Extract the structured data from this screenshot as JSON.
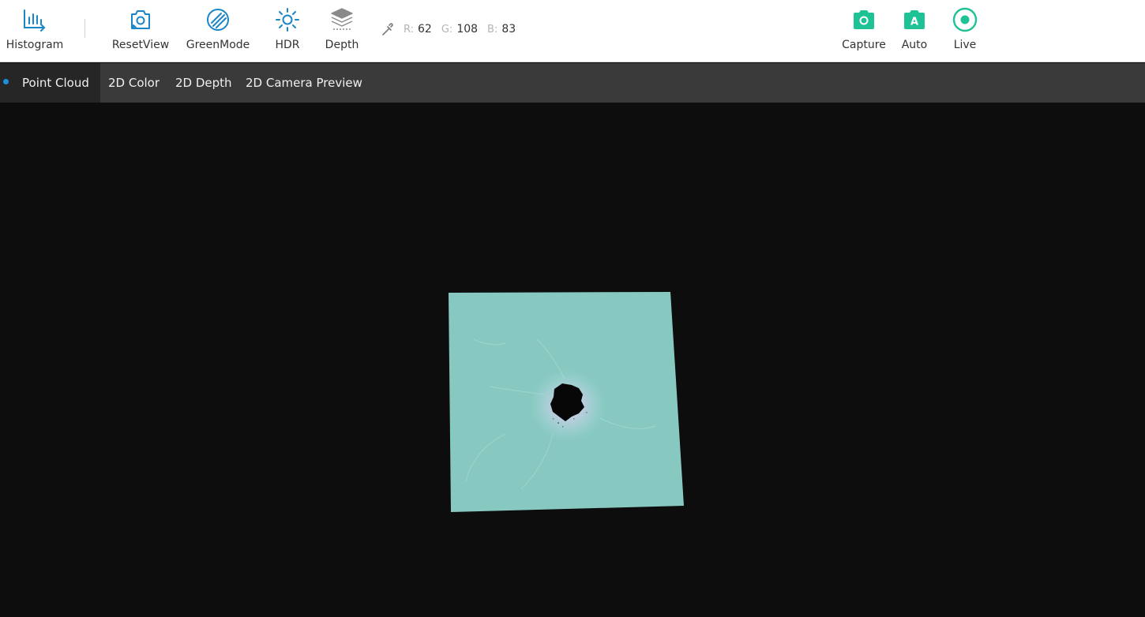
{
  "toolbar": {
    "left": [
      {
        "id": "histogram",
        "label": "Histogram",
        "icon": "histogram-icon"
      },
      {
        "id": "resetview",
        "label": "ResetView",
        "icon": "reset-view-camera-icon"
      },
      {
        "id": "greenmode",
        "label": "GreenMode",
        "icon": "green-mode-icon"
      },
      {
        "id": "hdr",
        "label": "HDR",
        "icon": "sun-icon"
      },
      {
        "id": "depth",
        "label": "Depth",
        "icon": "layers-icon"
      }
    ],
    "right": [
      {
        "id": "capture",
        "label": "Capture",
        "icon": "capture-camera-icon"
      },
      {
        "id": "auto",
        "label": "Auto",
        "icon": "auto-camera-icon",
        "glyph": "A"
      },
      {
        "id": "live",
        "label": "Live",
        "icon": "live-record-icon"
      }
    ]
  },
  "rgb": {
    "r_label": "R:",
    "r_value": "62",
    "g_label": "G:",
    "g_value": "108",
    "b_label": "B:",
    "b_value": "83"
  },
  "tabs": [
    "Point Cloud",
    "2D Color",
    "2D Depth",
    "2D Camera Preview"
  ],
  "active_tab": "Point Cloud",
  "colors": {
    "accent_blue": "#1b86c6",
    "accent_green": "#1fc295",
    "point_cloud": "#87c9c0",
    "tab_indicator": "#1f8fdc"
  }
}
